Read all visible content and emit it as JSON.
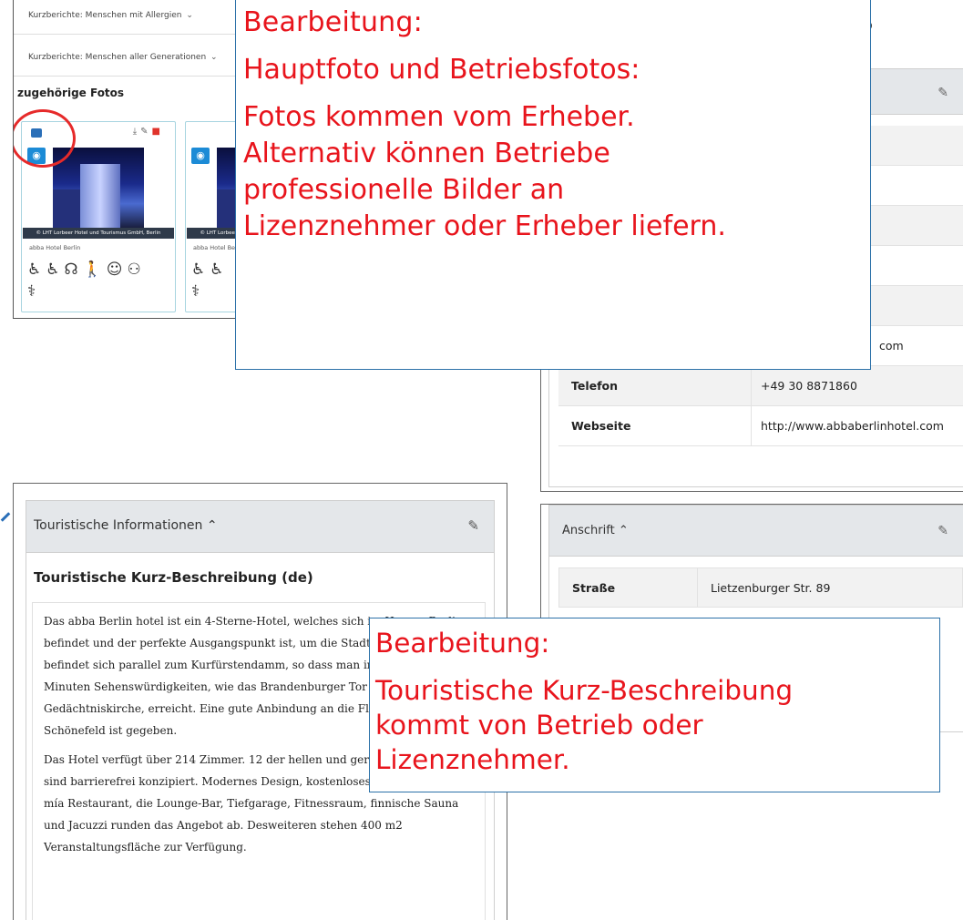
{
  "photos": {
    "dropdown1": "Kurzberichte: Menschen mit Allergien",
    "dropdown2": "Kurzberichte: Menschen aller Generationen",
    "heading": "zugehörige Fotos",
    "cards": [
      {
        "caption": "© LHT Lorbeer Hotel und Tourismus GmbH, Berlin",
        "name": "abba Hotel Berlin"
      },
      {
        "caption": "© LHT Lorbeer Hotel und Tourismus GmbH, Berlin",
        "name": "abba Hotel Berlin"
      }
    ]
  },
  "contact": {
    "title_suffix": "eb",
    "email_suffix": "com",
    "rows": [
      {
        "label": "Telefon",
        "value": "+49 30 8871860"
      },
      {
        "label": "Webseite",
        "value": "http://www.abbaberlinhotel.com"
      }
    ]
  },
  "address": {
    "title": "Anschrift",
    "rows": [
      {
        "label": "Straße",
        "value": "Lietzenburger Str. 89"
      }
    ]
  },
  "tourist": {
    "title": "Touristische Informationen",
    "subtitle": "Touristische Kurz-Beschreibung (de)",
    "paragraph1": "Das abba Berlin hotel ist ein 4-Sterne-Hotel, welches sich im Herzen Berlins befindet und der perfekte Ausgangspunkt ist, um die Stadt zu erkunden. Es befindet sich parallel zum Kurfürstendamm, so dass man in wenigen Minuten Sehenswürdigkeiten, wie das Brandenburger Tor oder die Gedächtniskirche, erreicht. Eine gute Anbindung an die Flughäfen Tegel und Schönefeld ist gegeben.",
    "paragraph2": "Das Hotel verfügt über 214 Zimmer. 12 der hellen und geräumigen Zimmer sind barrierefrei konzipiert. Modernes Design, kostenloses WLAN, das abba mía Restaurant, die Lounge-Bar, Tiefgarage, Fitnessraum, finnische Sauna und Jacuzzi runden das Angebot ab. Desweiteren stehen 400 m2 Veranstaltungsfläche zur Verfügung."
  },
  "callout1": {
    "line1": "Bearbeitung:",
    "line2": "Hauptfoto und Betriebsfotos:",
    "line3": "Fotos kommen vom Erheber.",
    "line4": "Alternativ können Betriebe",
    "line5": "professionelle Bilder an",
    "line6": "Lizenznehmer oder Erheber liefern."
  },
  "callout2": {
    "line1": "Bearbeitung:",
    "line2": "Touristische Kurz-Beschreibung",
    "line3": "kommt von Betrieb oder",
    "line4": "Lizenznehmer."
  },
  "icons": {
    "accessibility": [
      "wheelchair-ramp-icon",
      "wheelchair-icon",
      "hearing-icon",
      "walking-icon",
      "child-icon",
      "family-icon",
      "allergy-icon"
    ],
    "edit": "edit-icon",
    "view": "eye-icon"
  },
  "colors": {
    "annotation_red": "#e8141c",
    "annotation_border": "#2c71a8",
    "panel_header": "#e4e7ea",
    "accent_blue": "#1c8bd6",
    "delete_red": "#e0332b"
  }
}
